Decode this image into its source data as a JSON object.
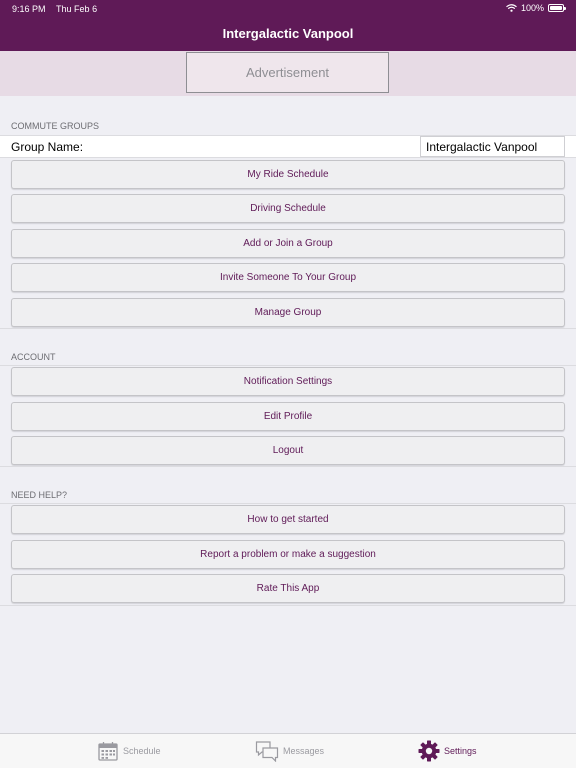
{
  "status_bar": {
    "time": "9:16 PM",
    "date": "Thu Feb 6",
    "battery": "100%"
  },
  "nav": {
    "title": "Intergalactic Vanpool"
  },
  "ad": {
    "label": "Advertisement"
  },
  "sections": {
    "commute": {
      "header": "COMMUTE GROUPS",
      "group_name_label": "Group Name:",
      "group_name_value": "Intergalactic Vanpool",
      "buttons": [
        "My Ride Schedule",
        "Driving Schedule",
        "Add or Join a Group",
        "Invite Someone To Your Group",
        "Manage Group"
      ]
    },
    "account": {
      "header": "ACCOUNT",
      "buttons": [
        "Notification Settings",
        "Edit Profile",
        "Logout"
      ]
    },
    "help": {
      "header": "NEED HELP?",
      "buttons": [
        "How to get started",
        "Report a problem or make a suggestion",
        "Rate This App"
      ]
    }
  },
  "tabbar": {
    "tabs": [
      {
        "label": "Schedule",
        "icon": "calendar-icon"
      },
      {
        "label": "Messages",
        "icon": "chat-bubbles-icon"
      },
      {
        "label": "Settings",
        "icon": "gear-icon",
        "active": true
      }
    ]
  },
  "colors": {
    "brand": "#5f1a57",
    "ad_band": "#e7dbe5",
    "background": "#efeff4",
    "tab_inactive": "#9a9aa0"
  }
}
